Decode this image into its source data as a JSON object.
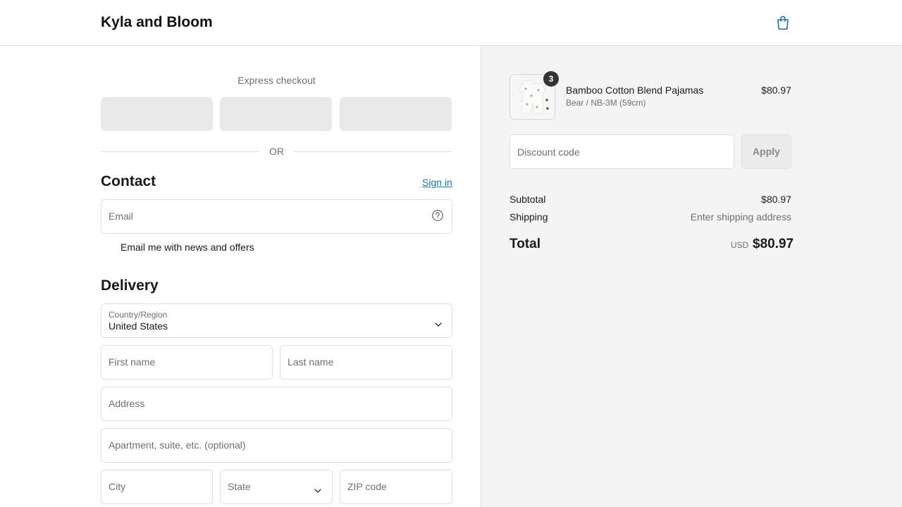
{
  "header": {
    "brand": "Kyla and Bloom",
    "cart_icon": "shopping-bag-icon"
  },
  "express": {
    "title": "Express checkout",
    "or_text": "OR"
  },
  "contact": {
    "title": "Contact",
    "signin_label": "Sign in",
    "email_placeholder": "Email",
    "newsletter_label": "Email me with news and offers"
  },
  "delivery": {
    "title": "Delivery",
    "country_label": "Country/Region",
    "country_value": "United States",
    "first_name_placeholder": "First name",
    "last_name_placeholder": "Last name",
    "address_placeholder": "Address",
    "apartment_placeholder": "Apartment, suite, etc. (optional)",
    "city_placeholder": "City",
    "state_placeholder": "State",
    "zip_placeholder": "ZIP code"
  },
  "summary": {
    "item": {
      "quantity": "3",
      "name": "Bamboo Cotton Blend Pajamas",
      "variant": "Bear / NB-3M (59cm)",
      "price": "$80.97"
    },
    "discount_placeholder": "Discount code",
    "apply_label": "Apply",
    "subtotal_label": "Subtotal",
    "subtotal_value": "$80.97",
    "shipping_label": "Shipping",
    "shipping_value": "Enter shipping address",
    "total_label": "Total",
    "total_currency": "USD",
    "total_value": "$80.97"
  },
  "colors": {
    "link": "#1773b0",
    "summary_bg": "#f4f4f4",
    "border": "#dedede"
  }
}
